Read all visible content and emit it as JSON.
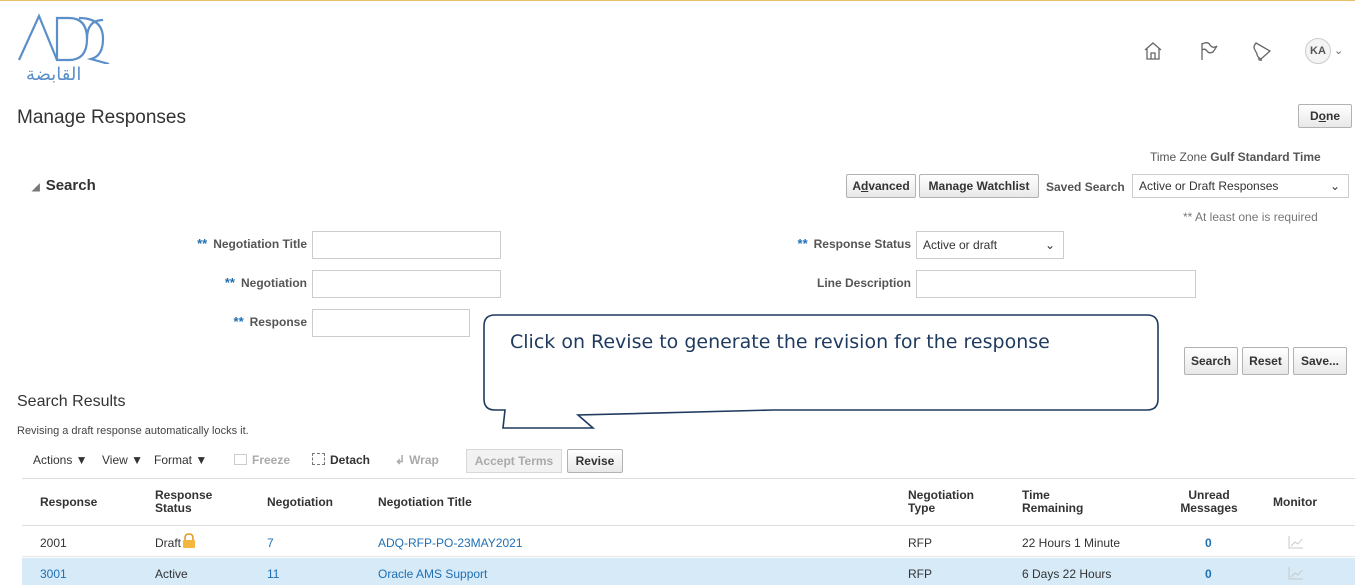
{
  "brand": {
    "logo_text": "ADQ",
    "logo_arabic": "القابضة"
  },
  "header": {
    "icons": [
      "home-icon",
      "flag-icon",
      "bell-icon"
    ],
    "avatar_initials": "KA"
  },
  "page": {
    "title": "Manage Responses",
    "done_label": "Done"
  },
  "timezone": {
    "label": "Time Zone",
    "value": "Gulf Standard Time"
  },
  "search": {
    "header": "Search",
    "advanced_label": "Advanced",
    "watchlist_label": "Manage Watchlist",
    "saved_search_label": "Saved Search",
    "saved_search_value": "Active or Draft Responses",
    "required_note": "** At least one is required",
    "fields": {
      "negotiation_title": {
        "label": "Negotiation Title",
        "value": ""
      },
      "negotiation": {
        "label": "Negotiation",
        "value": ""
      },
      "response": {
        "label": "Response",
        "value": ""
      },
      "response_status": {
        "label": "Response Status",
        "value": "Active or draft"
      },
      "line_description": {
        "label": "Line Description",
        "value": ""
      }
    },
    "required_marker": "**",
    "search_label": "Search",
    "reset_label": "Reset",
    "save_label": "Save..."
  },
  "callout": {
    "text": "Click on Revise to generate the revision for the response"
  },
  "results": {
    "title": "Search Results",
    "note": "Revising a draft response automatically locks it.",
    "toolbar": {
      "actions": "Actions ▼",
      "view": "View ▼",
      "format": "Format ▼",
      "freeze": "Freeze",
      "detach": "Detach",
      "wrap": "Wrap",
      "accept_terms": "Accept Terms",
      "revise": "Revise"
    },
    "columns": {
      "response": "Response",
      "response_status": "Response Status",
      "negotiation": "Negotiation",
      "negotiation_title": "Negotiation Title",
      "negotiation_type": "Negotiation Type",
      "time_remaining": "Time Remaining",
      "unread_messages": "Unread Messages",
      "monitor": "Monitor"
    },
    "rows": [
      {
        "response": "2001",
        "status": "Draft",
        "locked": true,
        "negotiation": "7",
        "title": "ADQ-RFP-PO-23MAY2021",
        "type": "RFP",
        "time": "22 Hours 1 Minute",
        "unread": "0",
        "selected": false
      },
      {
        "response": "3001",
        "status": "Active",
        "locked": false,
        "negotiation": "11",
        "title": "Oracle AMS Support",
        "type": "RFP",
        "time": "6 Days 22 Hours",
        "unread": "0",
        "selected": true
      }
    ]
  },
  "colors": {
    "accent_link": "#1f6fb3",
    "selected_row": "#d6eaf8",
    "callout_border": "#1f3a5f"
  }
}
